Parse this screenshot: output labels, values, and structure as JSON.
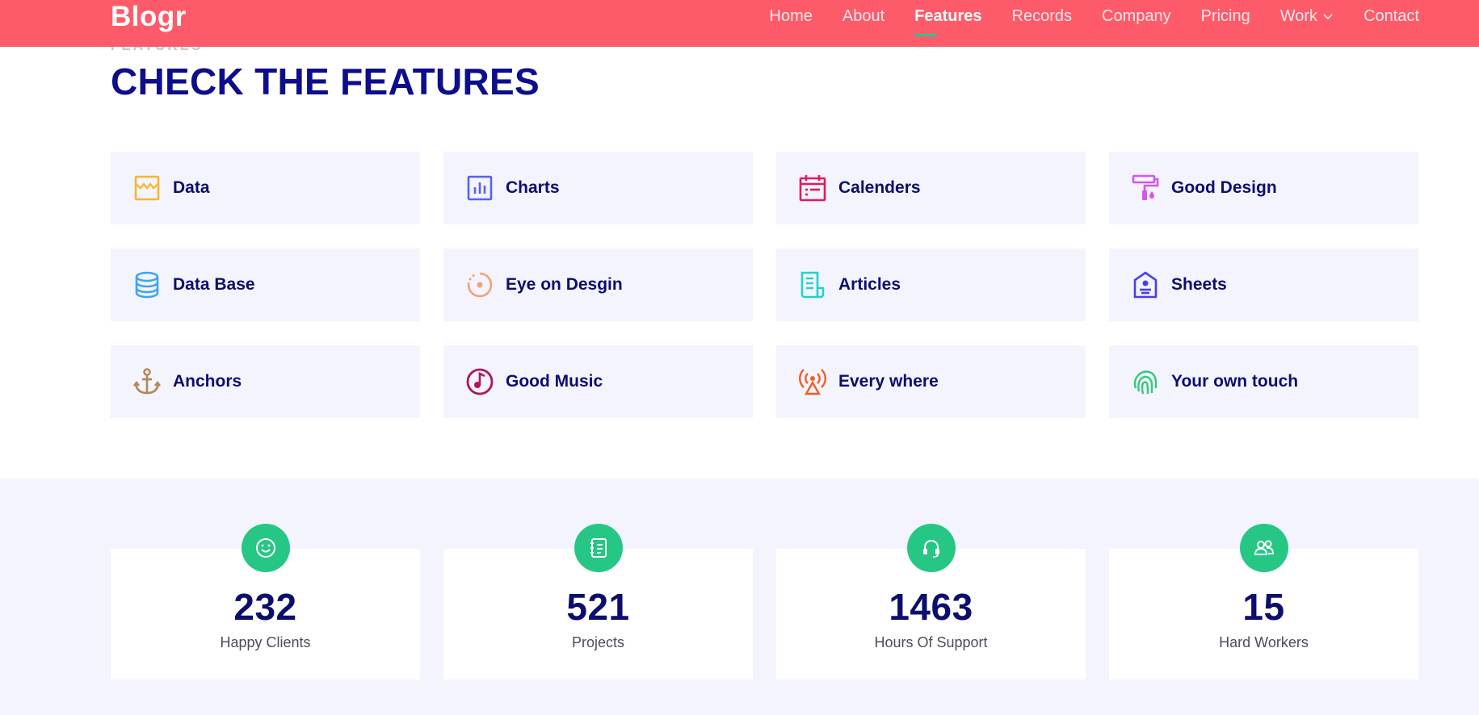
{
  "header": {
    "logo": "Blogr",
    "nav": [
      {
        "label": "Home",
        "active": false
      },
      {
        "label": "About",
        "active": false
      },
      {
        "label": "Features",
        "active": true
      },
      {
        "label": "Records",
        "active": false
      },
      {
        "label": "Company",
        "active": false
      },
      {
        "label": "Pricing",
        "active": false
      },
      {
        "label": "Work",
        "active": false,
        "dropdown": true
      },
      {
        "label": "Contact",
        "active": false
      }
    ]
  },
  "section": {
    "subtitle": "FEATURES",
    "title": "CHECK THE FEATURES"
  },
  "features": [
    {
      "label": "Data",
      "icon": "window-icon",
      "color": "#f7b731"
    },
    {
      "label": "Charts",
      "icon": "bar-chart-icon",
      "color": "#5563f0"
    },
    {
      "label": "Calenders",
      "icon": "calendar-icon",
      "color": "#e5175d"
    },
    {
      "label": "Good Design",
      "icon": "paint-roller-icon",
      "color": "#d455f0"
    },
    {
      "label": "Data Base",
      "icon": "database-icon",
      "color": "#3ea4f5"
    },
    {
      "label": "Eye on Desgin",
      "icon": "target-icon",
      "color": "#f7a06e"
    },
    {
      "label": "Articles",
      "icon": "document-icon",
      "color": "#26d0ce"
    },
    {
      "label": "Sheets",
      "icon": "user-tag-icon",
      "color": "#4a3df0"
    },
    {
      "label": "Anchors",
      "icon": "anchor-icon",
      "color": "#b08856"
    },
    {
      "label": "Good Music",
      "icon": "music-note-icon",
      "color": "#b0155f"
    },
    {
      "label": "Every where",
      "icon": "broadcast-icon",
      "color": "#f25d23"
    },
    {
      "label": "Your own touch",
      "icon": "fingerprint-icon",
      "color": "#34c97a"
    }
  ],
  "stats": [
    {
      "number": "232",
      "label": "Happy Clients",
      "icon": "smile-icon"
    },
    {
      "number": "521",
      "label": "Projects",
      "icon": "notebook-icon"
    },
    {
      "number": "1463",
      "label": "Hours Of Support",
      "icon": "headset-icon"
    },
    {
      "number": "15",
      "label": "Hard Workers",
      "icon": "users-icon"
    }
  ],
  "colors": {
    "header_bg": "#fe5b6a",
    "accent_green": "#26c784",
    "title_navy": "#0c0e8b",
    "card_bg": "#f3f4fd"
  }
}
